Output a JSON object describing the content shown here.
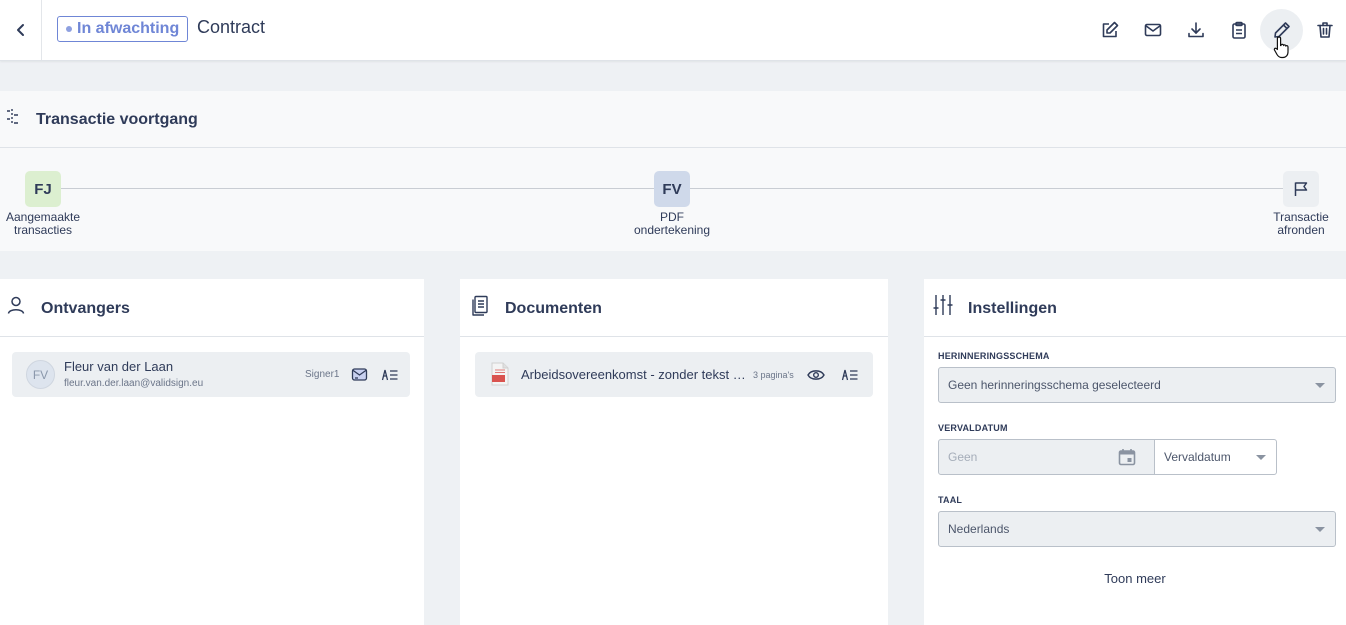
{
  "header": {
    "status": "In afwachting",
    "title": "Contract",
    "toolbar_icons": [
      "edit-document-icon",
      "mail-icon",
      "download-icon",
      "clipboard-icon",
      "pencil-icon",
      "trash-icon"
    ]
  },
  "progress": {
    "title": "Transactie voortgang",
    "steps": [
      {
        "initials": "FJ",
        "label_line1": "Aangemaakte",
        "label_line2": "transacties",
        "color": "#dcefd0"
      },
      {
        "initials": "FV",
        "label_line1": "PDF",
        "label_line2": "ondertekening",
        "color": "#cfd9ea"
      },
      {
        "initials": "",
        "icon": "flag-icon",
        "label_line1": "Transactie",
        "label_line2": "afronden",
        "color": "#eceff2"
      }
    ]
  },
  "recipients": {
    "title": "Ontvangers",
    "items": [
      {
        "initials": "FV",
        "name": "Fleur van der Laan",
        "email": "fleur.van.der.laan@validsign.eu",
        "role": "Signer1"
      }
    ]
  },
  "documents": {
    "title": "Documenten",
    "items": [
      {
        "name": "Arbeidsovereenkomst - zonder tekst velden",
        "pages": "3 pagina's"
      }
    ]
  },
  "settings": {
    "title": "Instellingen",
    "reminder_label": "HERINNERINGSSCHEMA",
    "reminder_value": "Geen herinneringsschema geselecteerd",
    "expiry_label": "VERVALDATUM",
    "expiry_placeholder": "Geen",
    "expiry_select": "Vervaldatum",
    "language_label": "TAAL",
    "language_value": "Nederlands",
    "show_more": "Toon meer"
  },
  "colors": {
    "accent": "#6f86d6",
    "text": "#2f3b59",
    "background": "#eef1f4"
  }
}
